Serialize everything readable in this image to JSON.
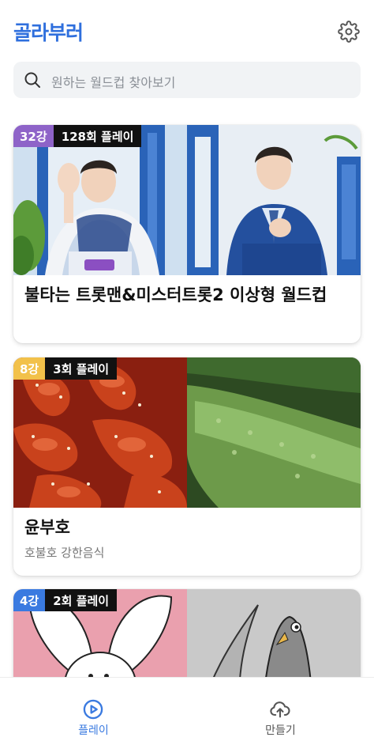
{
  "app": {
    "logo": "골라부러"
  },
  "search": {
    "placeholder": "원하는 월드컵 찾아보기"
  },
  "colors": {
    "brand": "#2f6fdd",
    "badge_purple": "#8e63c8",
    "badge_yellow": "#f2c14a",
    "badge_blue": "#3a7ae0",
    "nav_active": "#3a7ae0",
    "nav_inactive": "#555555"
  },
  "cards": [
    {
      "round": "32강",
      "plays": "128회 플레이",
      "title": "불타는 트롯맨&미스터트롯2 이상형 월드컵",
      "subtitle": "",
      "thumb_left": "photo-man-waving",
      "thumb_right": "photo-man-blue-suit"
    },
    {
      "round": "8강",
      "plays": "3회 플레이",
      "title": "윤부호",
      "subtitle": "호불호 강한음식",
      "thumb_left": "photo-spicy-chicken-feet",
      "thumb_right": "photo-cucumber"
    },
    {
      "round": "4강",
      "plays": "2회 플레이",
      "title": "",
      "subtitle": "",
      "thumb_left": "drawing-white-rabbit",
      "thumb_right": "drawing-pigeon"
    }
  ],
  "nav": [
    {
      "label": "플레이",
      "icon": "play-circle-icon",
      "active": true
    },
    {
      "label": "만들기",
      "icon": "cloud-upload-icon",
      "active": false
    }
  ]
}
